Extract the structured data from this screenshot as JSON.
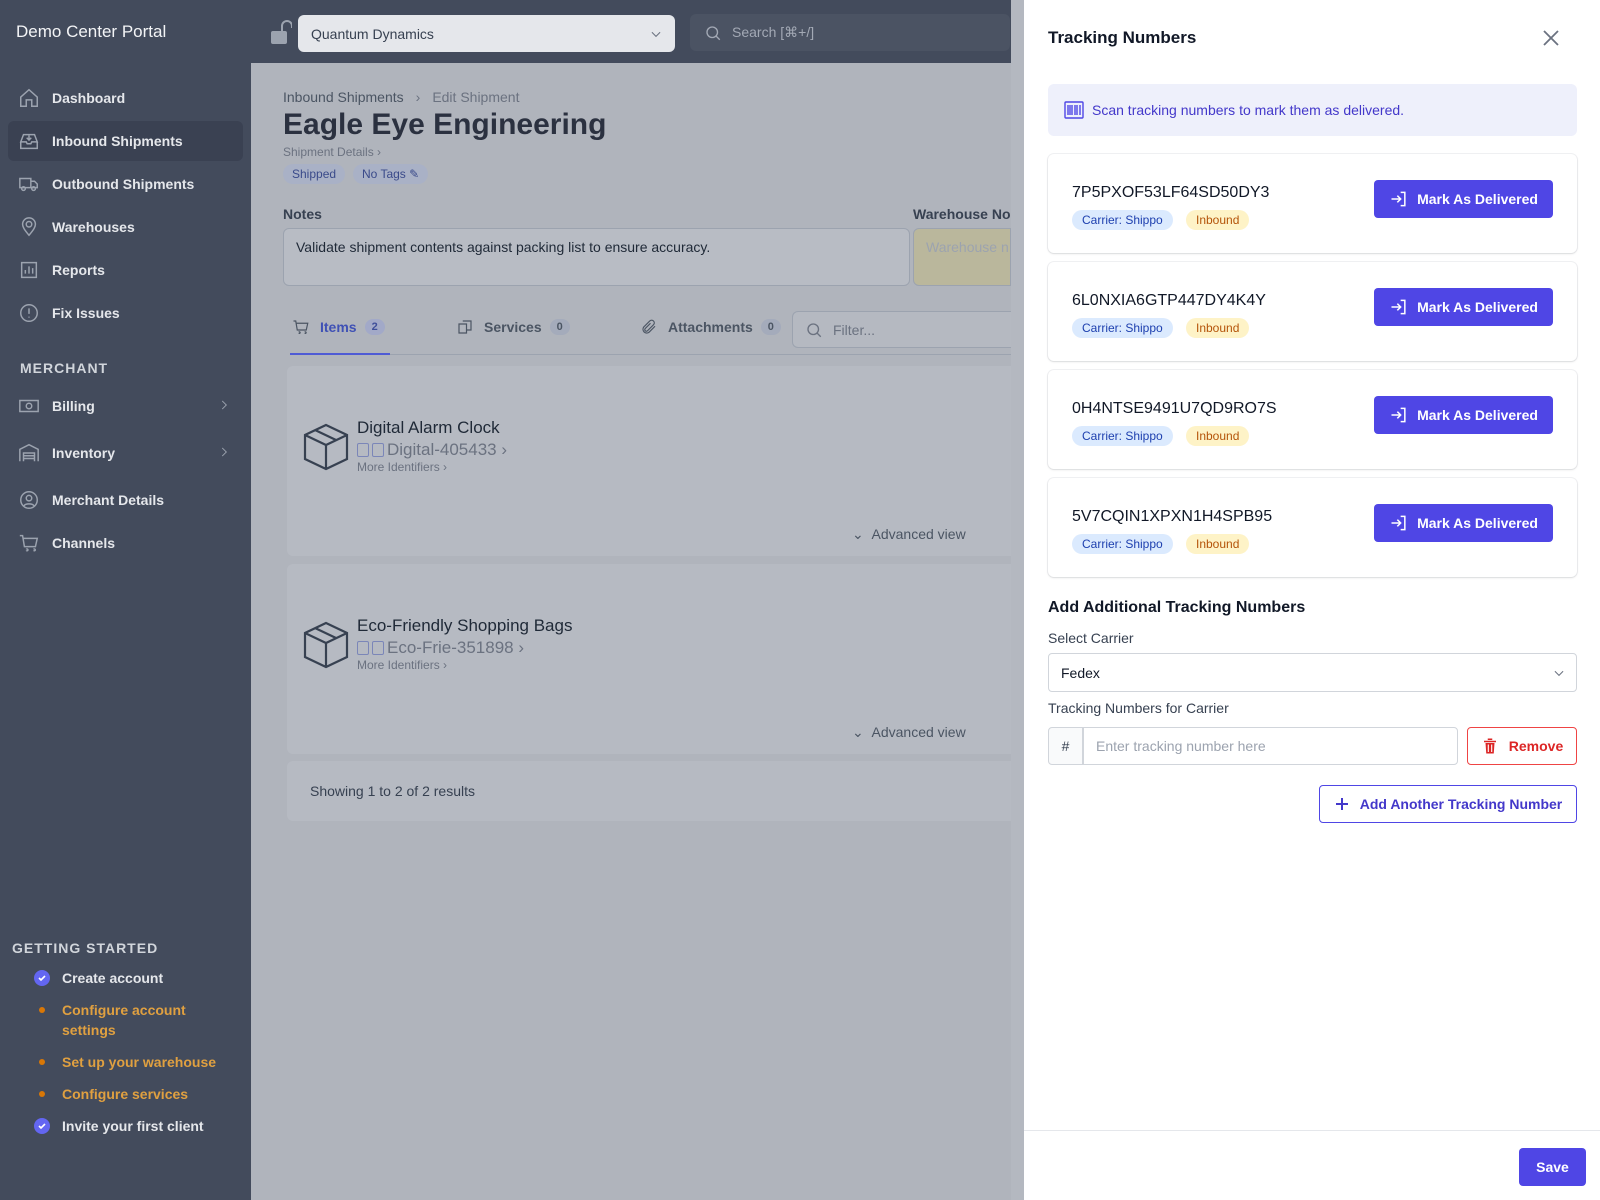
{
  "sidebar": {
    "brand": "Demo Center Portal",
    "items": [
      {
        "label": "Dashboard"
      },
      {
        "label": "Inbound Shipments"
      },
      {
        "label": "Outbound Shipments"
      },
      {
        "label": "Warehouses"
      },
      {
        "label": "Reports"
      },
      {
        "label": "Fix Issues"
      }
    ],
    "merchant_heading": "MERCHANT",
    "merchant_items": [
      {
        "label": "Billing"
      },
      {
        "label": "Inventory"
      },
      {
        "label": "Merchant Details"
      },
      {
        "label": "Channels"
      }
    ],
    "getting_started_heading": "GETTING STARTED",
    "getting_started": [
      {
        "label": "Create account",
        "status": "done"
      },
      {
        "label": "Configure account settings",
        "status": "todo"
      },
      {
        "label": "Set up your warehouse",
        "status": "todo"
      },
      {
        "label": "Configure services",
        "status": "todo"
      },
      {
        "label": "Invite your first client",
        "status": "done"
      }
    ]
  },
  "topbar": {
    "org_selected": "Quantum Dynamics",
    "search_placeholder": "Search [⌘+/]"
  },
  "main": {
    "breadcrumb": [
      "Inbound Shipments",
      "Edit Shipment"
    ],
    "title": "Eagle Eye Engineering",
    "sub_link": "Shipment Details",
    "tags": [
      "Shipped",
      "No Tags"
    ],
    "notes_label": "Notes",
    "notes_value": "Validate shipment contents against packing list to ensure accuracy.",
    "warehouse_notes_label": "Warehouse No",
    "warehouse_notes_placeholder": "Warehouse n",
    "tabs": [
      {
        "label": "Items",
        "count": "2"
      },
      {
        "label": "Services",
        "count": "0"
      },
      {
        "label": "Attachments",
        "count": "0"
      }
    ],
    "filter_placeholder": "Filter...",
    "items": [
      {
        "name": "Digital Alarm Clock",
        "sku": "Digital-405433",
        "more": "More Identifiers",
        "advanced": "Advanced view"
      },
      {
        "name": "Eco-Friendly Shopping Bags",
        "sku": "Eco-Frie-351898",
        "more": "More Identifiers",
        "advanced": "Advanced view"
      }
    ],
    "results_text": "Showing 1 to 2 of 2 results"
  },
  "drawer": {
    "title": "Tracking Numbers",
    "info_text": "Scan tracking numbers to mark them as delivered.",
    "tracking": [
      {
        "number": "7P5PXOF53LF64SD50DY3",
        "carrier": "Carrier: Shippo",
        "direction": "Inbound",
        "action": "Mark As Delivered"
      },
      {
        "number": "6L0NXIA6GTP447DY4K4Y",
        "carrier": "Carrier: Shippo",
        "direction": "Inbound",
        "action": "Mark As Delivered"
      },
      {
        "number": "0H4NTSE9491U7QD9RO7S",
        "carrier": "Carrier: Shippo",
        "direction": "Inbound",
        "action": "Mark As Delivered"
      },
      {
        "number": "5V7CQIN1XPXN1H4SPB95",
        "carrier": "Carrier: Shippo",
        "direction": "Inbound",
        "action": "Mark As Delivered"
      }
    ],
    "add_heading": "Add Additional Tracking Numbers",
    "select_carrier_label": "Select Carrier",
    "carrier_selected": "Fedex",
    "tracking_for_carrier_label": "Tracking Numbers for Carrier",
    "hash_symbol": "#",
    "tracking_input_placeholder": "Enter tracking number here",
    "remove_label": "Remove",
    "add_another_label": "Add Another Tracking Number",
    "save_label": "Save"
  },
  "colors": {
    "accent": "#4f46e5",
    "sidebar_bg": "#434b5c",
    "danger": "#dc2626"
  }
}
